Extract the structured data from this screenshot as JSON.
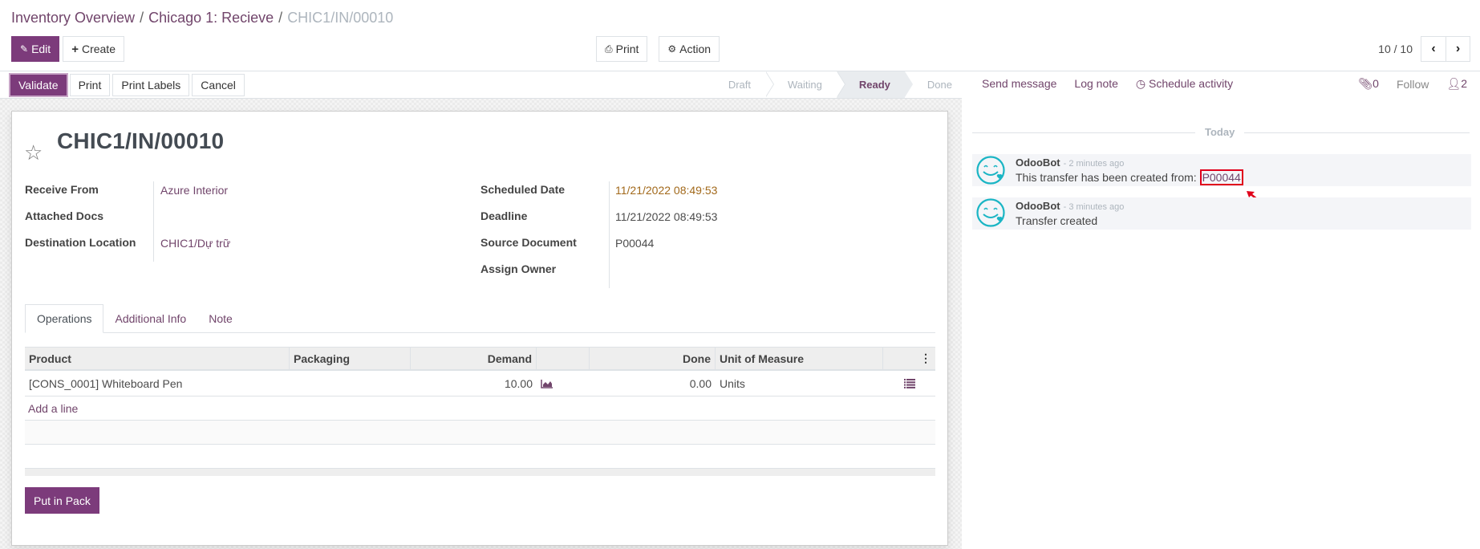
{
  "breadcrumb": {
    "items": [
      "Inventory Overview",
      "Chicago 1: Recieve"
    ],
    "current": "CHIC1/IN/00010",
    "separator": "/"
  },
  "toolbar": {
    "edit_label": "Edit",
    "create_label": "Create",
    "print_label": "Print",
    "action_label": "Action",
    "edit_icon": "pencil-icon",
    "create_icon": "plus-icon",
    "print_icon": "printer-icon",
    "action_icon": "gear-icon"
  },
  "pager": {
    "value": "10 / 10",
    "prev_icon": "chevron-left-icon",
    "next_icon": "chevron-right-icon"
  },
  "statusbar": {
    "buttons": [
      "Validate",
      "Print",
      "Print Labels",
      "Cancel"
    ],
    "stages": [
      {
        "label": "Draft",
        "active": false
      },
      {
        "label": "Waiting",
        "active": false
      },
      {
        "label": "Ready",
        "active": true
      },
      {
        "label": "Done",
        "active": false
      }
    ]
  },
  "record": {
    "title": "CHIC1/IN/00010",
    "favorite_icon": "star-outline-icon",
    "left_fields": [
      {
        "label": "Receive From",
        "value": "Azure Interior",
        "link": true
      },
      {
        "label": "Attached Docs",
        "value": ""
      },
      {
        "label": "Destination Location",
        "value": "CHIC1/Dự trữ",
        "link": true
      }
    ],
    "right_fields": [
      {
        "label": "Scheduled Date",
        "value": "11/21/2022 08:49:53",
        "color": "#a2691b"
      },
      {
        "label": "Deadline",
        "value": "11/21/2022 08:49:53"
      },
      {
        "label": "Source Document",
        "value": "P00044"
      },
      {
        "label": "Assign Owner",
        "value": ""
      }
    ]
  },
  "tabs": [
    {
      "label": "Operations",
      "active": true
    },
    {
      "label": "Additional Info",
      "active": false
    },
    {
      "label": "Note",
      "active": false
    }
  ],
  "operations_table": {
    "columns": [
      "Product",
      "Packaging",
      "Demand",
      "",
      "Done",
      "Unit of Measure"
    ],
    "rows": [
      {
        "product": "[CONS_0001] Whiteboard Pen",
        "packaging": "",
        "demand": "10.00",
        "forecast_icon": "area-chart-icon",
        "done": "0.00",
        "uom": "Units",
        "detail_icon": "list-icon"
      }
    ],
    "add_line_label": "Add a line",
    "options_icon": "vertical-ellipsis-icon"
  },
  "put_in_pack_label": "Put in Pack",
  "chatter": {
    "send_message": "Send message",
    "log_note": "Log note",
    "schedule_activity": "Schedule activity",
    "attachments_count": "0",
    "follow_label": "Follow",
    "followers_count": "2",
    "date_separator": "Today",
    "messages": [
      {
        "author": "OdooBot",
        "time": "- 2 minutes ago",
        "body": "This transfer has been created from:",
        "link": "P00044"
      },
      {
        "author": "OdooBot",
        "time": "- 3 minutes ago",
        "body": "Transfer created"
      }
    ]
  },
  "colors": {
    "brand": "#7c3b7b",
    "link": "#71456b",
    "highlight_box": "#e0001b",
    "bot_avatar": "#1ab5c4"
  }
}
